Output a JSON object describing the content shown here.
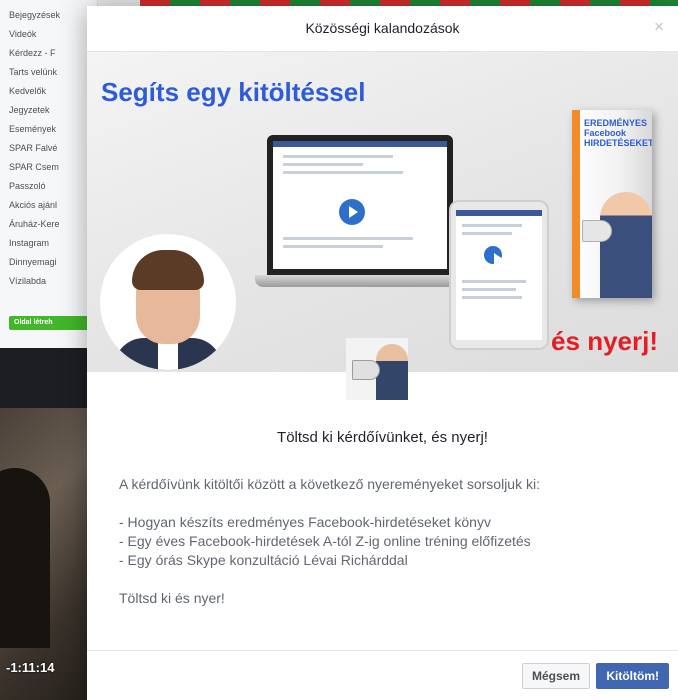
{
  "background": {
    "sidebar_items": [
      "Bejegyzések",
      "Videók",
      "Kérdezz - F",
      "Tarts velünk",
      "Kedvelők",
      "Jegyzetek",
      "Események",
      "SPAR Falvé",
      "SPAR Csem",
      "Passzoló",
      "Akciós ajánl",
      "Áruház-Kere",
      "Instagram",
      "Dinnyemagi",
      "Vízilabda"
    ],
    "create_button": "Oldal létreh",
    "video_time": "-1:11:14"
  },
  "modal": {
    "title": "Közösségi kalandozások",
    "close_glyph": "×",
    "banner": {
      "heading": "Segíts egy kitöltéssel",
      "win_text": "és nyerj!",
      "book_text": "EREDMÉNYES Facebook HIRDETÉSEKET?"
    },
    "intro": "Töltsd ki kérdőívünket, és nyerj!",
    "description": "A kérdőívünk kitöltői között a következő nyereményeket sorsoljuk ki:",
    "prizes": [
      "- Hogyan készíts eredményes Facebook-hirdetéseket könyv",
      "- Egy éves Facebook-hirdetések A-tól Z-ig online tréning előfizetés",
      "- Egy órás Skype konzultáció Lévai Richárddal"
    ],
    "closing": "Töltsd ki és nyer!",
    "buttons": {
      "cancel": "Mégsem",
      "confirm": "Kitöltöm!"
    }
  },
  "colors": {
    "primary": "#4267b2",
    "heading_blue": "#2e5cd9",
    "win_red": "#e31e24"
  }
}
